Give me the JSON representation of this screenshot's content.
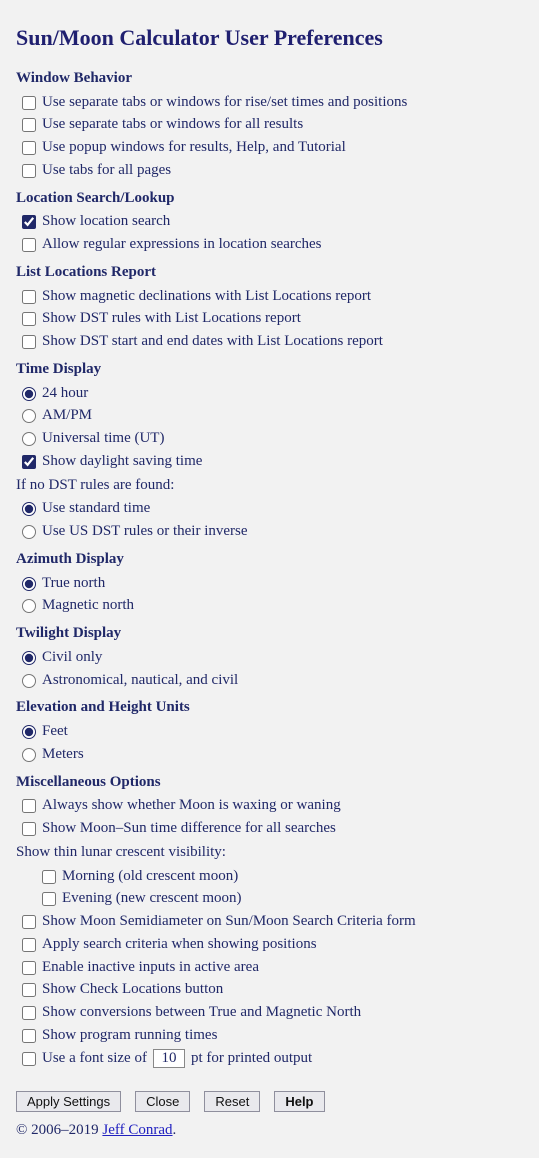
{
  "title": "Sun/Moon Calculator User Preferences",
  "sections": {
    "windowBehavior": {
      "heading": "Window Behavior",
      "opts": {
        "sepTabsRiseSet": {
          "label": "Use separate tabs or windows for rise/set times and positions",
          "checked": false
        },
        "sepTabsAll": {
          "label": "Use separate tabs or windows for all results",
          "checked": false
        },
        "popupWindows": {
          "label": "Use popup windows for results, Help, and Tutorial",
          "checked": false
        },
        "tabsAll": {
          "label": "Use tabs for all pages",
          "checked": false
        }
      }
    },
    "locationSearch": {
      "heading": "Location Search/Lookup",
      "opts": {
        "showSearch": {
          "label": "Show location search",
          "checked": true
        },
        "allowRegex": {
          "label": "Allow regular expressions in location searches",
          "checked": false
        }
      }
    },
    "listLocations": {
      "heading": "List Locations Report",
      "opts": {
        "magDecl": {
          "label": "Show magnetic declinations with List Locations report",
          "checked": false
        },
        "dstRules": {
          "label": "Show DST rules with List Locations report",
          "checked": false
        },
        "dstDates": {
          "label": "Show DST start and end dates with List Locations report",
          "checked": false
        }
      }
    },
    "timeDisplay": {
      "heading": "Time Display",
      "format": {
        "selected": "24hour",
        "opts": {
          "h24": {
            "label": "24 hour",
            "value": "24hour"
          },
          "ampm": {
            "label": "AM/PM",
            "value": "ampm"
          },
          "ut": {
            "label": "Universal time (UT)",
            "value": "ut"
          }
        }
      },
      "showDst": {
        "label": "Show daylight saving time",
        "checked": true
      },
      "noDstNote": "If no DST rules are found:",
      "fallback": {
        "selected": "standard",
        "opts": {
          "standard": {
            "label": "Use standard time",
            "value": "standard"
          },
          "usdst": {
            "label": "Use US DST rules or their inverse",
            "value": "usdst"
          }
        }
      }
    },
    "azimuth": {
      "heading": "Azimuth Display",
      "selected": "true-north",
      "opts": {
        "trueN": {
          "label": "True north",
          "value": "true-north"
        },
        "magN": {
          "label": "Magnetic north",
          "value": "magnetic-north"
        }
      }
    },
    "twilight": {
      "heading": "Twilight Display",
      "selected": "civil",
      "opts": {
        "civil": {
          "label": "Civil only",
          "value": "civil"
        },
        "anc": {
          "label": "Astronomical, nautical, and civil",
          "value": "anc"
        }
      }
    },
    "elevation": {
      "heading": "Elevation and Height Units",
      "selected": "feet",
      "opts": {
        "feet": {
          "label": "Feet",
          "value": "feet"
        },
        "meters": {
          "label": "Meters",
          "value": "meters"
        }
      }
    },
    "misc": {
      "heading": "Miscellaneous Options",
      "opts": {
        "waxWane": {
          "label": "Always show whether Moon is waxing or waning",
          "checked": false
        },
        "moonSunDiff": {
          "label": "Show Moon–Sun time difference for all searches",
          "checked": false
        }
      },
      "crescentNote": "Show thin lunar crescent visibility:",
      "crescent": {
        "morning": {
          "label": "Morning (old crescent moon)",
          "checked": false
        },
        "evening": {
          "label": "Evening (new crescent moon)",
          "checked": false
        }
      },
      "more": {
        "semidiam": {
          "label": "Show Moon Semidiameter on Sun/Moon Search Criteria form",
          "checked": false
        },
        "applyCrit": {
          "label": "Apply search criteria when showing positions",
          "checked": false
        },
        "enableInact": {
          "label": "Enable inactive inputs in active area",
          "checked": false
        },
        "checkLoc": {
          "label": "Show Check Locations button",
          "checked": false
        },
        "convTrueMag": {
          "label": "Show conversions between True and Magnetic North",
          "checked": false
        },
        "runTimes": {
          "label": "Show program running times",
          "checked": false
        }
      },
      "fontLine": {
        "prefix": "Use a font size of",
        "value": "10",
        "suffix": "pt for printed output",
        "checked": false
      }
    }
  },
  "buttons": {
    "apply": "Apply Settings",
    "close": "Close",
    "reset": "Reset",
    "help": "Help"
  },
  "footer": {
    "prefix": "© 2006–2019 ",
    "linkText": "Jeff Conrad",
    "suffix": "."
  }
}
